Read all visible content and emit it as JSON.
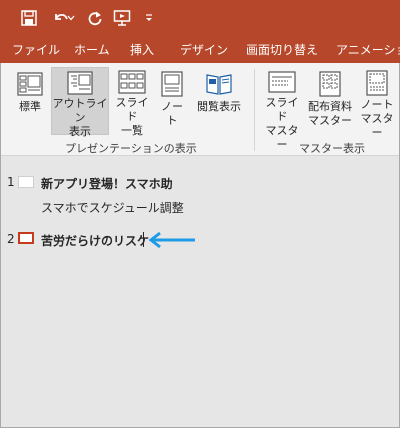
{
  "colors": {
    "brand": "#b7472a",
    "ribbon": "#f3f3f3",
    "pane": "#e6e6e6",
    "arrow": "#1e9be6",
    "selected_thumb": "#c43b1d"
  },
  "qat": {
    "icons": [
      "save-icon",
      "undo-icon",
      "dropdown-arrow-icon",
      "redo-icon",
      "slideshow-from-start-icon",
      "customize-qat-icon"
    ]
  },
  "tabs": [
    "ファイル",
    "ホーム",
    "挿入",
    "デザイン",
    "画面切り替え",
    "アニメーショ"
  ],
  "ribbon": {
    "presentation_views": {
      "label": "プレゼンテーションの表示",
      "buttons": [
        "標準",
        "アウトライン\n表示",
        "スライド\n一覧",
        "ノー\nト",
        "閲覧表示"
      ],
      "active_index": 1
    },
    "master_views": {
      "label": "マスター表示",
      "buttons": [
        "スライド\nマスター",
        "配布資料\nマスター",
        "ノート\nマスター"
      ]
    }
  },
  "outline": {
    "slides": [
      {
        "number": "1",
        "title": "新アプリ登場！スマホ助",
        "bullets": [
          "スマホでスケジュール調整"
        ]
      },
      {
        "number": "2",
        "title": "苦労だらけのリスケ",
        "bullets": []
      }
    ]
  }
}
